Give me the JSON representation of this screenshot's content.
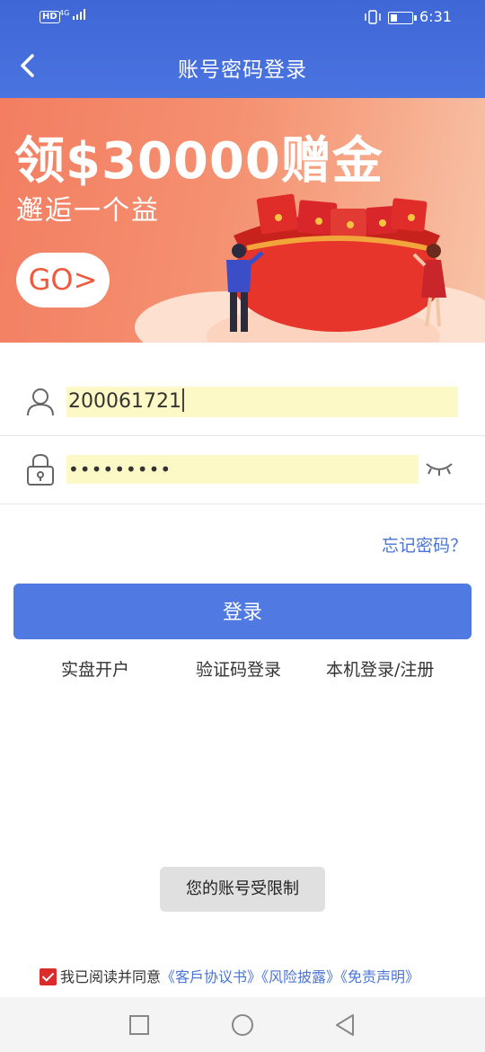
{
  "status_bar": {
    "hd": "HD",
    "signal": "4G",
    "time": "6:31"
  },
  "header": {
    "title": "账号密码登录",
    "back_icon": "chevron-left-icon"
  },
  "banner": {
    "title": "领$30000赠金",
    "subtitle": "邂逅一个益",
    "go_label": "GO>"
  },
  "form": {
    "account_value": "200061721",
    "password_value": "•••••••••",
    "user_icon": "user-icon",
    "lock_icon": "lock-icon",
    "eye_icon": "eye-closed-icon",
    "forgot_label": "忘记密码？",
    "login_label": "登录"
  },
  "links": {
    "open_account": "实盘开户",
    "sms_login": "验证码登录",
    "device_login": "本机登录/注册"
  },
  "toast": "您的账号受限制",
  "agreement": {
    "prefix": "我已阅读并同意",
    "doc1": "《客戶协议书》",
    "doc2": "《风险披露》",
    "doc3": "《免责声明》",
    "checked": true
  },
  "colors": {
    "header_blue": "#4a74e0",
    "button_blue": "#5079e2",
    "link_blue": "#4a74d6",
    "banner_orange": "#f37e62",
    "check_red": "#dc2b2b"
  }
}
